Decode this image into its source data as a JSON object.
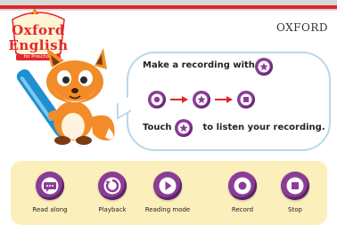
{
  "header": {
    "logo_line1": "Oxford",
    "logo_line2": "English",
    "logo_sub": "for Preschool",
    "brand": "OXFORD"
  },
  "instructions": {
    "line1": "Make a recording with",
    "line3_prefix": "Touch",
    "line3_suffix": "to listen your recording."
  },
  "toolbar": {
    "buttons": [
      {
        "label": "Read along",
        "icon": "speech-bubble-icon"
      },
      {
        "label": "Playback",
        "icon": "replay-arrow-icon"
      },
      {
        "label": "Reading mode",
        "icon": "play-triangle-icon"
      },
      {
        "label": "Record",
        "icon": "record-dot-icon"
      },
      {
        "label": "Stop",
        "icon": "stop-square-icon"
      }
    ]
  },
  "colors": {
    "accent_purple": "#8a3c96",
    "brand_red": "#e3262a",
    "toolbar_bg": "#fbefbb",
    "bubble_border": "#b8d8ea"
  }
}
